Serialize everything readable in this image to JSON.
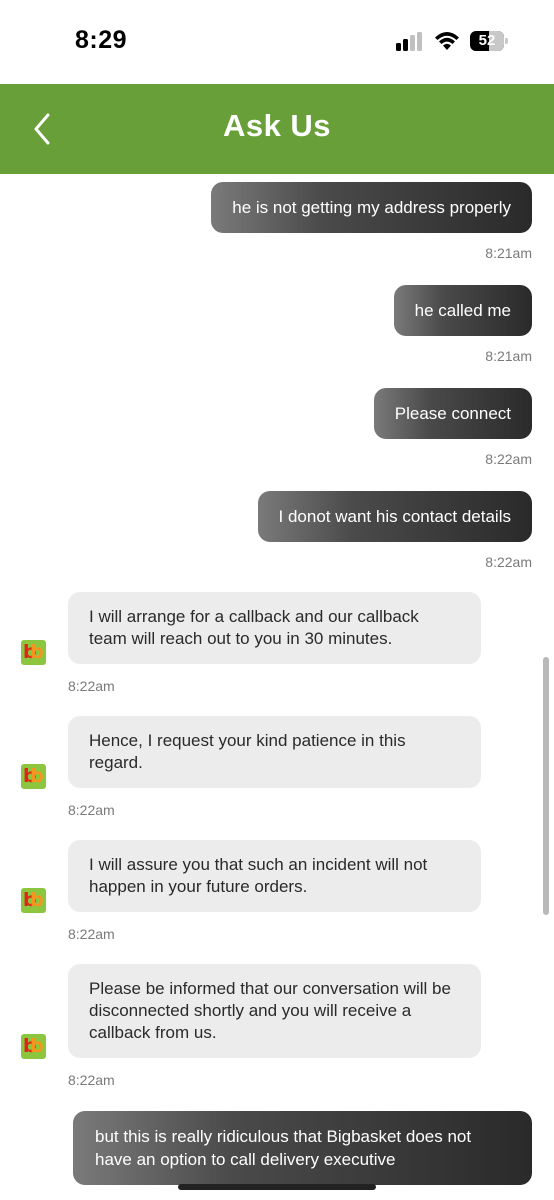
{
  "status_bar": {
    "time": "8:29",
    "battery_level": "52",
    "icons": [
      "signal-icon",
      "wifi-icon",
      "battery-icon"
    ]
  },
  "header": {
    "title": "Ask Us",
    "back_icon": "chevron-left-icon",
    "background_color": "#689f38"
  },
  "messages": [
    {
      "sender": "user",
      "text": "he is not getting my address properly",
      "time": "8:21am"
    },
    {
      "sender": "user",
      "text": "he called me",
      "time": "8:21am"
    },
    {
      "sender": "user",
      "text": "Please connect",
      "time": "8:22am"
    },
    {
      "sender": "user",
      "text": "I donot want his contact details",
      "time": "8:22am"
    },
    {
      "sender": "bot",
      "text": "I will arrange for a callback and our callback team will reach out to you in 30 minutes.",
      "time": "8:22am",
      "avatar": "bb"
    },
    {
      "sender": "bot",
      "text": "Hence, I request your kind patience in this regard.",
      "time": "8:22am",
      "avatar": "bb"
    },
    {
      "sender": "bot",
      "text": "I will assure you that such an incident will not happen in your future orders.",
      "time": "8:22am",
      "avatar": "bb"
    },
    {
      "sender": "bot",
      "text": "Please be informed that our conversation will be disconnected shortly and you will receive a callback from us.",
      "time": "8:22am",
      "avatar": "bb"
    },
    {
      "sender": "user",
      "text": "but this is really ridiculous that Bigbasket does not have an option to call delivery executive",
      "time": ""
    }
  ],
  "colors": {
    "user_bubble": "#2a2a2a",
    "bot_bubble": "#ececec",
    "avatar_bg": "#8cc63f"
  }
}
